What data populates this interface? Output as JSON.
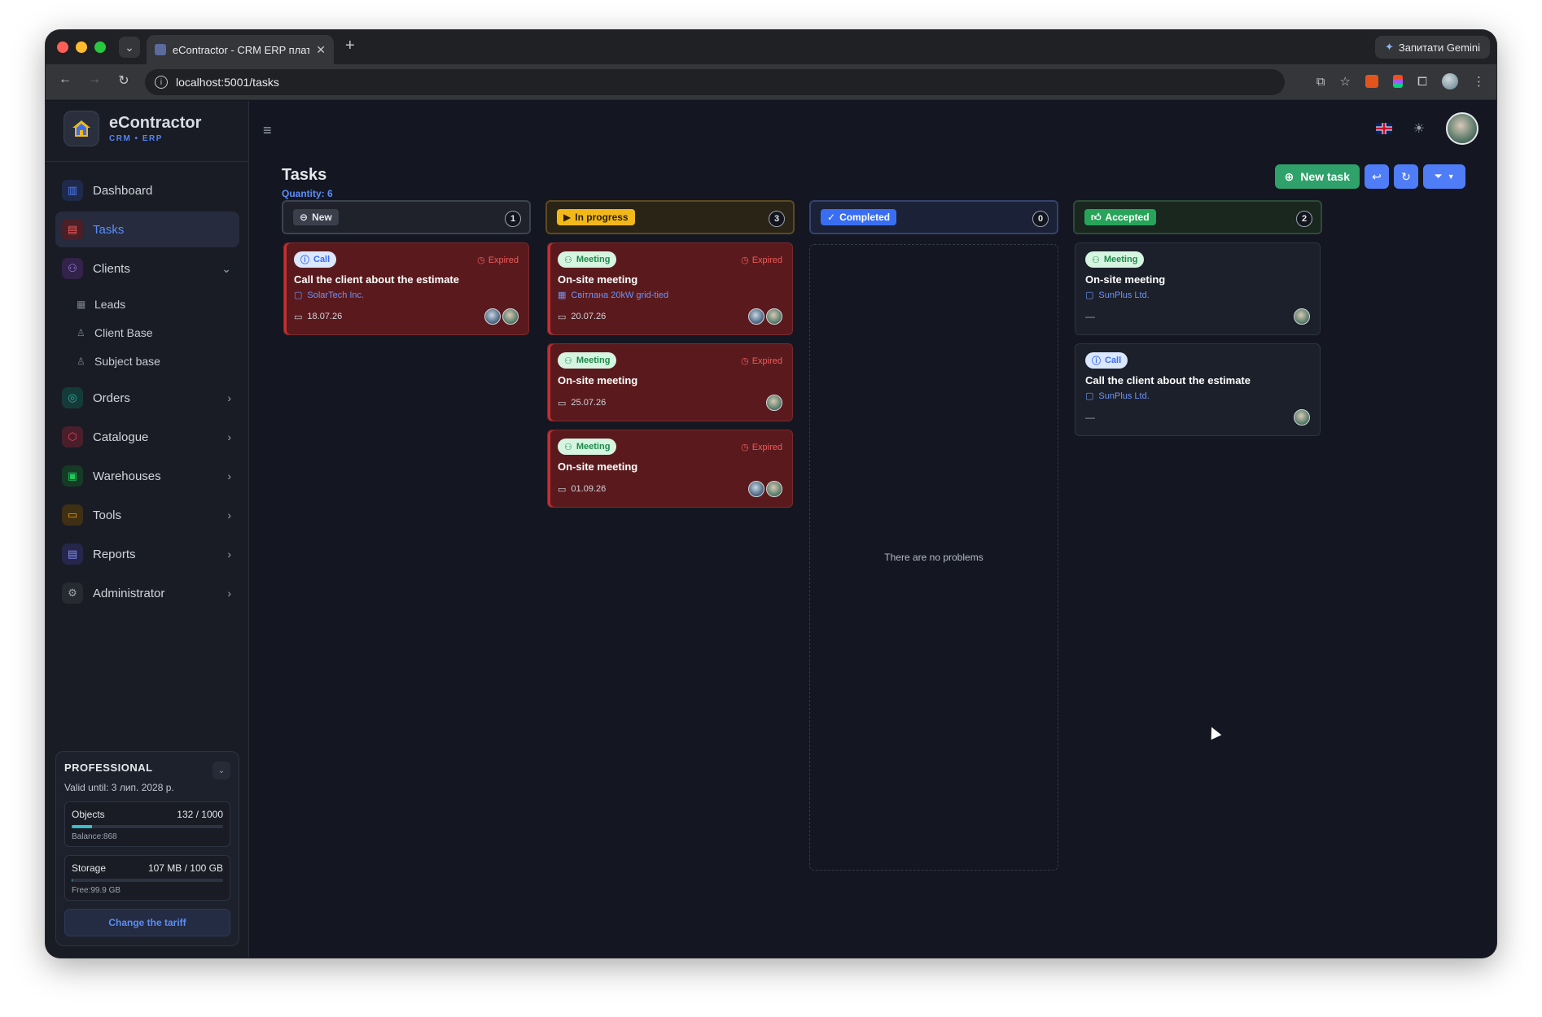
{
  "browser": {
    "tab_title": "eContractor - CRM ERP платф",
    "url": "localhost:5001/tasks",
    "gemini_label": "Запитати Gemini"
  },
  "sidebar": {
    "brand_name": "eContractor",
    "brand_sub": "CRM • ERP",
    "items": [
      {
        "label": "Dashboard",
        "icon": "chart-bars-icon",
        "color": "#4f7cf7"
      },
      {
        "label": "Tasks",
        "icon": "clipboard-icon",
        "color": "#ef5b5b"
      },
      {
        "label": "Clients",
        "icon": "users-icon",
        "color": "#8b5cf6"
      },
      {
        "label": "Orders",
        "icon": "orders-icon",
        "color": "#14b8a6"
      },
      {
        "label": "Catalogue",
        "icon": "box-icon",
        "color": "#f43f5e"
      },
      {
        "label": "Warehouses",
        "icon": "warehouse-icon",
        "color": "#22c55e"
      },
      {
        "label": "Tools",
        "icon": "toolbox-icon",
        "color": "#f59e0b"
      },
      {
        "label": "Reports",
        "icon": "report-icon",
        "color": "#6366f1"
      },
      {
        "label": "Administrator",
        "icon": "gear-icon",
        "color": "#6b7280"
      }
    ],
    "clients_sub": [
      {
        "label": "Leads"
      },
      {
        "label": "Client Base"
      },
      {
        "label": "Subject base"
      }
    ],
    "plan": {
      "name": "PROFESSIONAL",
      "valid": "Valid until: 3 лип. 2028 р.",
      "objects_label": "Objects",
      "objects_value": "132 / 1000",
      "objects_fraction": 0.132,
      "balance": "Balance:868",
      "storage_label": "Storage",
      "storage_value": "107 MB / 100 GB",
      "storage_fraction": 0.001,
      "free": "Free:99.9 GB",
      "change_label": "Change the tariff"
    }
  },
  "page": {
    "title": "Tasks",
    "quantity": "Quantity: 6",
    "new_task_label": "New task"
  },
  "columns": [
    {
      "label": "New",
      "count": "1"
    },
    {
      "label": "In progress",
      "count": "3"
    },
    {
      "label": "Completed",
      "count": "0"
    },
    {
      "label": "Accepted",
      "count": "2"
    }
  ],
  "cards": {
    "new": [
      {
        "type": "Call",
        "status": "Expired",
        "title": "Call the client about the estimate",
        "client": "SolarTech Inc.",
        "date": "18.07.26"
      }
    ],
    "progress": [
      {
        "type": "Meeting",
        "status": "Expired",
        "title": "On-site meeting",
        "client": "Світлана 20kW grid-tied",
        "date": "20.07.26"
      },
      {
        "type": "Meeting",
        "status": "Expired",
        "title": "On-site meeting",
        "date": "25.07.26"
      },
      {
        "type": "Meeting",
        "status": "Expired",
        "title": "On-site meeting",
        "date": "01.09.26"
      }
    ],
    "accepted": [
      {
        "type": "Meeting",
        "title": "On-site meeting",
        "client": "SunPlus Ltd.",
        "date": "—"
      },
      {
        "type": "Call",
        "title": "Call the client about the estimate",
        "client": "SunPlus Ltd.",
        "date": "—"
      }
    ]
  },
  "completed_empty": "There are no problems"
}
